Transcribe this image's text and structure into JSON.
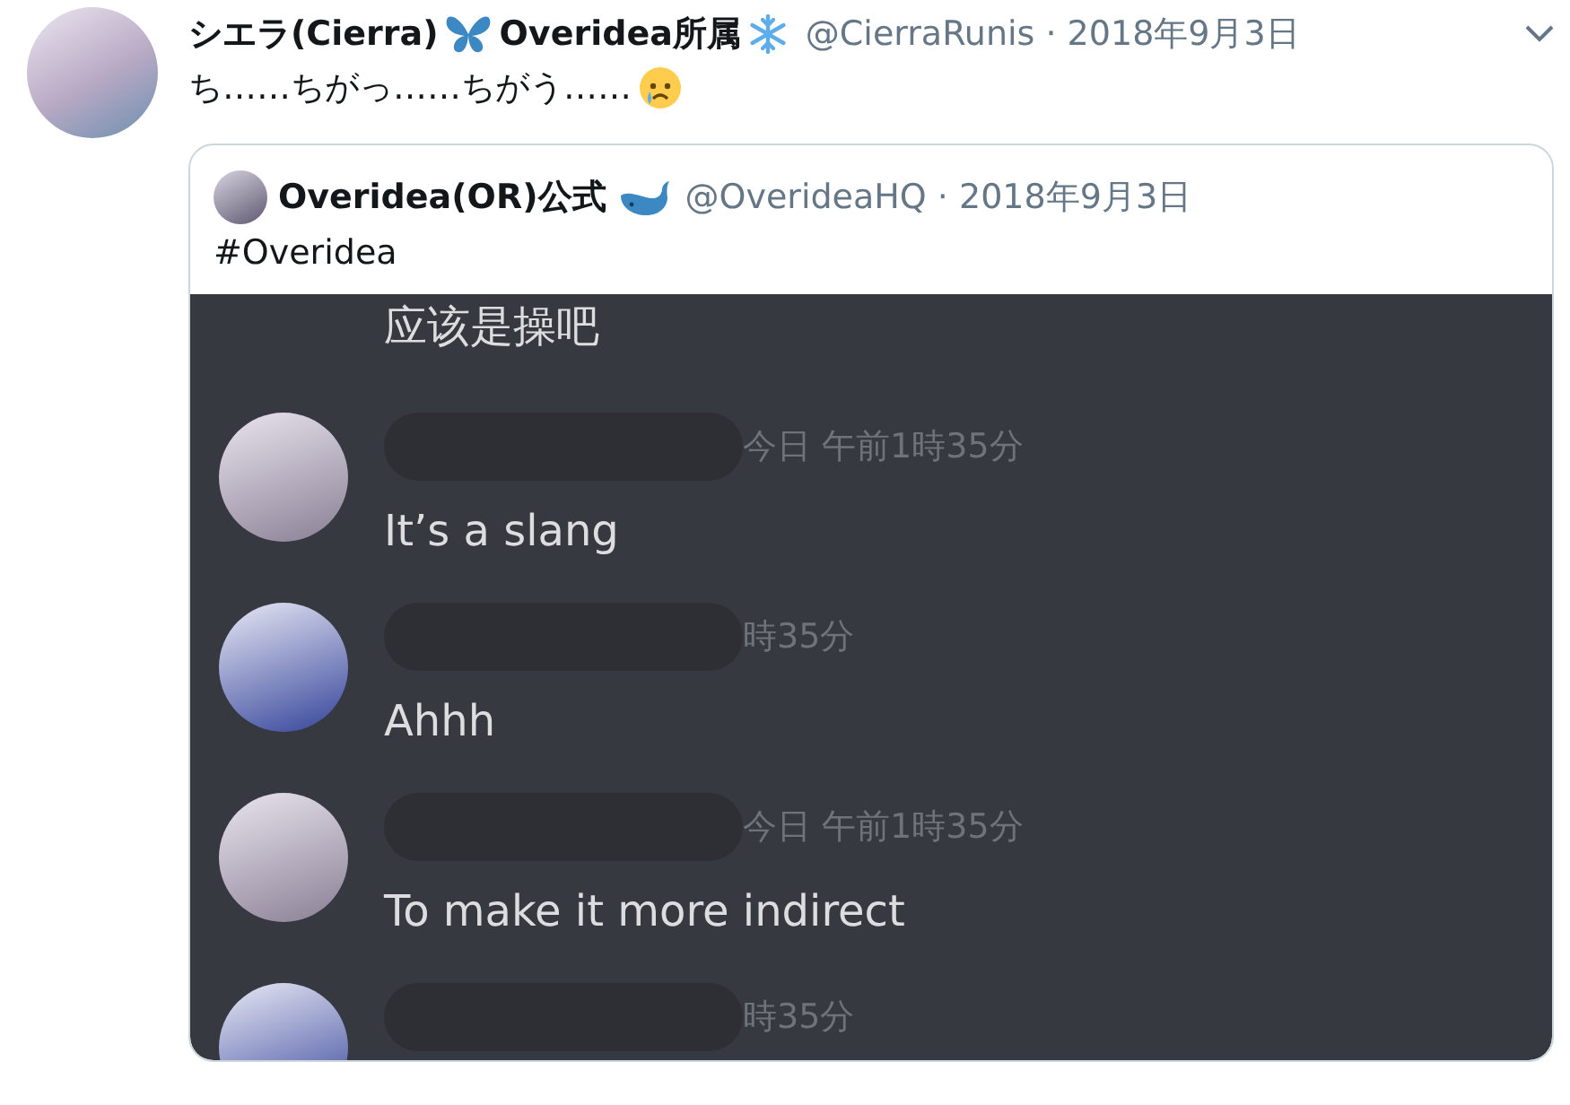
{
  "tweet": {
    "display_name": "シエラ(Cierra)",
    "display_name_suffix": "Overidea所属",
    "handle": "@CierraRunis",
    "separator": "·",
    "date": "2018年9月3日",
    "text": "ち……ちがっ……ちがう……",
    "quoted_tweet": {
      "display_name": "Overidea(OR)公式",
      "handle": "@OverideaHQ",
      "separator": "·",
      "date": "2018年9月3日",
      "text": "#Overidea",
      "chat_screenshot": {
        "messages": [
          {
            "kind": "continuation",
            "text": "应该是操吧"
          },
          {
            "kind": "message",
            "timestamp": "今日 午前1時35分",
            "text": "It’s a slang"
          },
          {
            "kind": "message",
            "timestamp": "時35分",
            "text": "Ahhh"
          },
          {
            "kind": "message",
            "timestamp": "今日 午前1時35分",
            "text": "To make it more indirect"
          },
          {
            "kind": "message",
            "timestamp": "時35分"
          }
        ]
      }
    }
  }
}
